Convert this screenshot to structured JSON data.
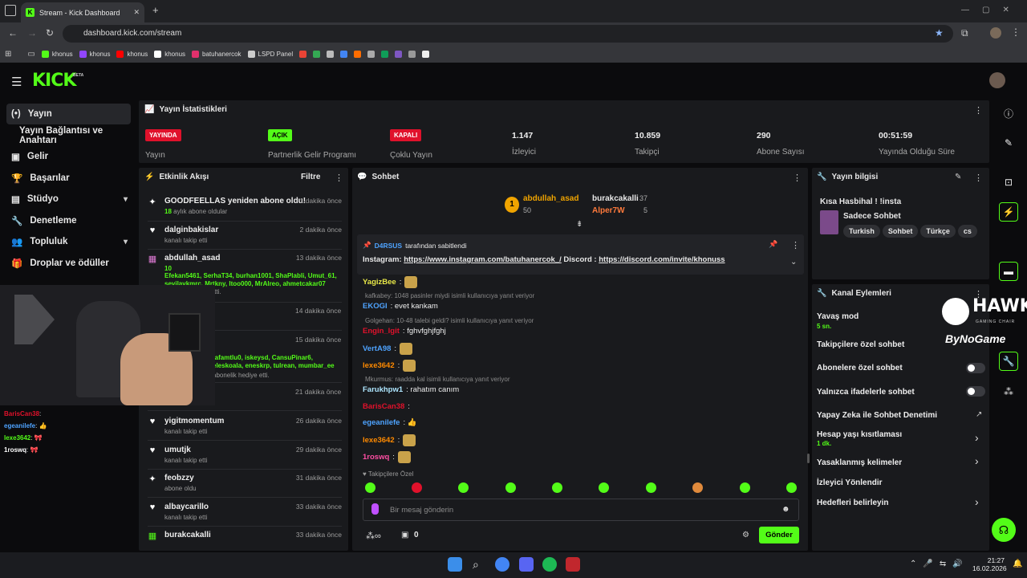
{
  "browser": {
    "tab_title": "Stream - Kick Dashboard",
    "url": "dashboard.kick.com/stream",
    "bookmarks": [
      {
        "label": "khonus",
        "color": "#53fc18"
      },
      {
        "label": "khonus",
        "color": "#9146ff"
      },
      {
        "label": "khonus",
        "color": "#ff0000"
      },
      {
        "label": "khonus",
        "color": "#ffffff"
      },
      {
        "label": "batuhanercok",
        "color": "#e1306c"
      },
      {
        "label": "LSPD Panel",
        "color": "#cccccc"
      }
    ]
  },
  "header": {
    "logo": "KICK",
    "beta": "BETA"
  },
  "sidebar": {
    "items": [
      {
        "label": "Yayın",
        "icon": "broadcast-icon"
      },
      {
        "label": "Yayın Bağlantısı ve Anahtarı",
        "icon": "key-icon"
      },
      {
        "label": "Gelir",
        "icon": "money-icon"
      },
      {
        "label": "Başarılar",
        "icon": "trophy-icon"
      },
      {
        "label": "Stüdyo",
        "icon": "studio-icon"
      },
      {
        "label": "Denetleme",
        "icon": "wrench-icon"
      },
      {
        "label": "Topluluk",
        "icon": "users-icon"
      },
      {
        "label": "Droplar ve ödüller",
        "icon": "gift-icon"
      }
    ]
  },
  "stats": {
    "title": "Yayın İstatistikleri",
    "cols": [
      {
        "badge": "YAYINDA",
        "label": "Yayın",
        "color": "#e0112b"
      },
      {
        "badge": "AÇIK",
        "label": "Partnerlik Gelir Programı",
        "color": "#53fc18"
      },
      {
        "badge": "KAPALI",
        "label": "Çoklu Yayın",
        "color": "#e0112b"
      },
      {
        "value": "1.147",
        "label": "İzleyici"
      },
      {
        "value": "10.859",
        "label": "Takipçi"
      },
      {
        "value": "290",
        "label": "Abone Sayısı"
      },
      {
        "value": "00:51:59",
        "label": "Yayında Olduğu Süre"
      }
    ]
  },
  "events": {
    "title": "Etkinlik Akışı",
    "filter": "Filtre",
    "items": [
      {
        "title": "GOODFEELLAS yeniden abone oldu!",
        "sub_num": "18",
        "sub": "aylık abone oldular",
        "time": "1 dakika önce",
        "icon": "sparkle-icon"
      },
      {
        "title": "dalginbakislar",
        "sub": "kanalı takip etti",
        "time": "2 dakika önce",
        "icon": "heart-icon"
      },
      {
        "title": "abdullah_asad",
        "sub": "10",
        "names": "Efekan5461, SerhaT34, burhan1001, ShaPlabli, Umut_61, sevilavkmrc, Mrtkny, Itoo000, MrAlreo, ahmetcakar07",
        "sub2": "abonelik hediye etti.",
        "time": "13 dakika önce",
        "icon": "gift-icon"
      },
      {
        "title": "",
        "sub": "",
        "time": "14 dakika önce",
        "icon": ""
      },
      {
        "title": "",
        "names": "tafamtlu0, iskeysd, CansuPinar6, eleskoala, eneskrp, tulrean, mumbar_ee",
        "sub2": "abonelik hediye etti.",
        "time": "15 dakika önce",
        "icon": ""
      },
      {
        "title": "",
        "sub": "",
        "time": "21 dakika önce",
        "icon": ""
      },
      {
        "title": "yigitmomentum",
        "sub": "kanalı takip etti",
        "time": "26 dakika önce",
        "icon": "heart-icon"
      },
      {
        "title": "umutjk",
        "sub": "kanalı takip etti",
        "time": "29 dakika önce",
        "icon": "heart-icon"
      },
      {
        "title": "feobzzy",
        "sub": "abone oldu",
        "time": "31 dakika önce",
        "icon": "sparkle-icon"
      },
      {
        "title": "albaycarillo",
        "sub": "kanalı takip etti",
        "time": "33 dakika önce",
        "icon": "heart-icon"
      },
      {
        "title": "burakcakalli",
        "sub": "",
        "time": "33 dakika önce",
        "icon": "gift-icon"
      }
    ]
  },
  "webcam_chat": [
    {
      "user": "BarisCan38",
      "text": ":",
      "color": "#e0112b"
    },
    {
      "user": "egeanilefe",
      "text": ": 👍",
      "color": "#4ea3ff"
    },
    {
      "user": "lexe3642",
      "text": ": 🎀",
      "color": "#53fc18"
    },
    {
      "user": "1roswq",
      "text": ": 🎀",
      "color": "#ffffff"
    }
  ],
  "chat": {
    "title": "Sohbet",
    "leaders": [
      {
        "rank": "1",
        "name": "abdullah_asad",
        "count": "50"
      },
      {
        "name": "burakcakalli",
        "count": "37"
      },
      {
        "name": "Alper7W",
        "count": "5"
      }
    ],
    "pinned_by": "D4RSUS",
    "pinned_suffix": "tarafından sabitlendi",
    "pinned_prefix": "Instagram:",
    "pinned_link1": "https://www.instagram.com/batuhanercok_/",
    "pinned_mid": "Discord :",
    "pinned_link2": "https://discord.com/invite/khonuss",
    "messages": [
      {
        "user": "YagizBee",
        "text": ":",
        "color": "#e8e848"
      },
      {
        "reply": "kafkabey: 1048 pasinler miydi isimli kullanıcıya yanıt veriyor",
        "user": "EKOGI",
        "text": ": evet kankam",
        "color": "#4ea3ff"
      },
      {
        "reply": "Golgehan: 10-48 talebi geldi? isimli kullanıcıya yanıt veriyor",
        "user": "Engin_lgit",
        "text": ": fghvfghjfghj",
        "color": "#e0112b"
      },
      {
        "user": "VertA98",
        "text": ":",
        "color": "#4ea3ff"
      },
      {
        "user": "lexe3642",
        "text": ":",
        "color": "#ff8a00"
      },
      {
        "reply": "Mkurmus: raadda kal isimli kullanıcıya yanıt veriyor",
        "user": "Farukhpw1",
        "text": ": rahatım canım",
        "color": "#aee6ff"
      },
      {
        "user": "BarisCan38",
        "text": ":",
        "color": "#e0112b"
      },
      {
        "user": "egeanilefe",
        "text": ": 👍",
        "color": "#4ea3ff"
      },
      {
        "user": "lexe3642",
        "text": ":",
        "color": "#ff8a00"
      },
      {
        "user": "1roswq",
        "text": ":",
        "color": "#ff4ea3"
      }
    ],
    "emote_label": "Takipçilere Özel",
    "placeholder": "Bir mesaj gönderin",
    "send": "Gönder",
    "points": "0"
  },
  "stream_info": {
    "title": "Yayın bilgisi",
    "stream_title": "Kısa Hasbihal ! !insta",
    "category": "Sadece Sohbet",
    "tags": [
      "Turkish",
      "Sohbet",
      "Türkçe",
      "cs"
    ]
  },
  "actions": {
    "title": "Kanal Eylemleri",
    "items": [
      {
        "label": "Yavaş mod",
        "sub": "5 sn."
      },
      {
        "label": "Takipçilere özel sohbet"
      },
      {
        "label": "Abonelere özel sohbet",
        "toggle": "off"
      },
      {
        "label": "Yalnızca ifadelerle sohbet",
        "toggle": "off"
      },
      {
        "label": "Yapay Zeka ile Sohbet Denetimi"
      },
      {
        "label": "Hesap yaşı kısıtlaması",
        "sub": "1 dk."
      },
      {
        "label": "Yasaklanmış kelimeler"
      },
      {
        "label": "İzleyici Yönlendir"
      },
      {
        "label": "Hedefleri belirleyin"
      }
    ]
  },
  "overlay": {
    "hawk": "HAWK",
    "hawk_sub": "GAMING CHAIR",
    "bynogame": "ByNoGame"
  },
  "taskbar": {
    "time": "21:27",
    "date": "16.02.2026"
  }
}
